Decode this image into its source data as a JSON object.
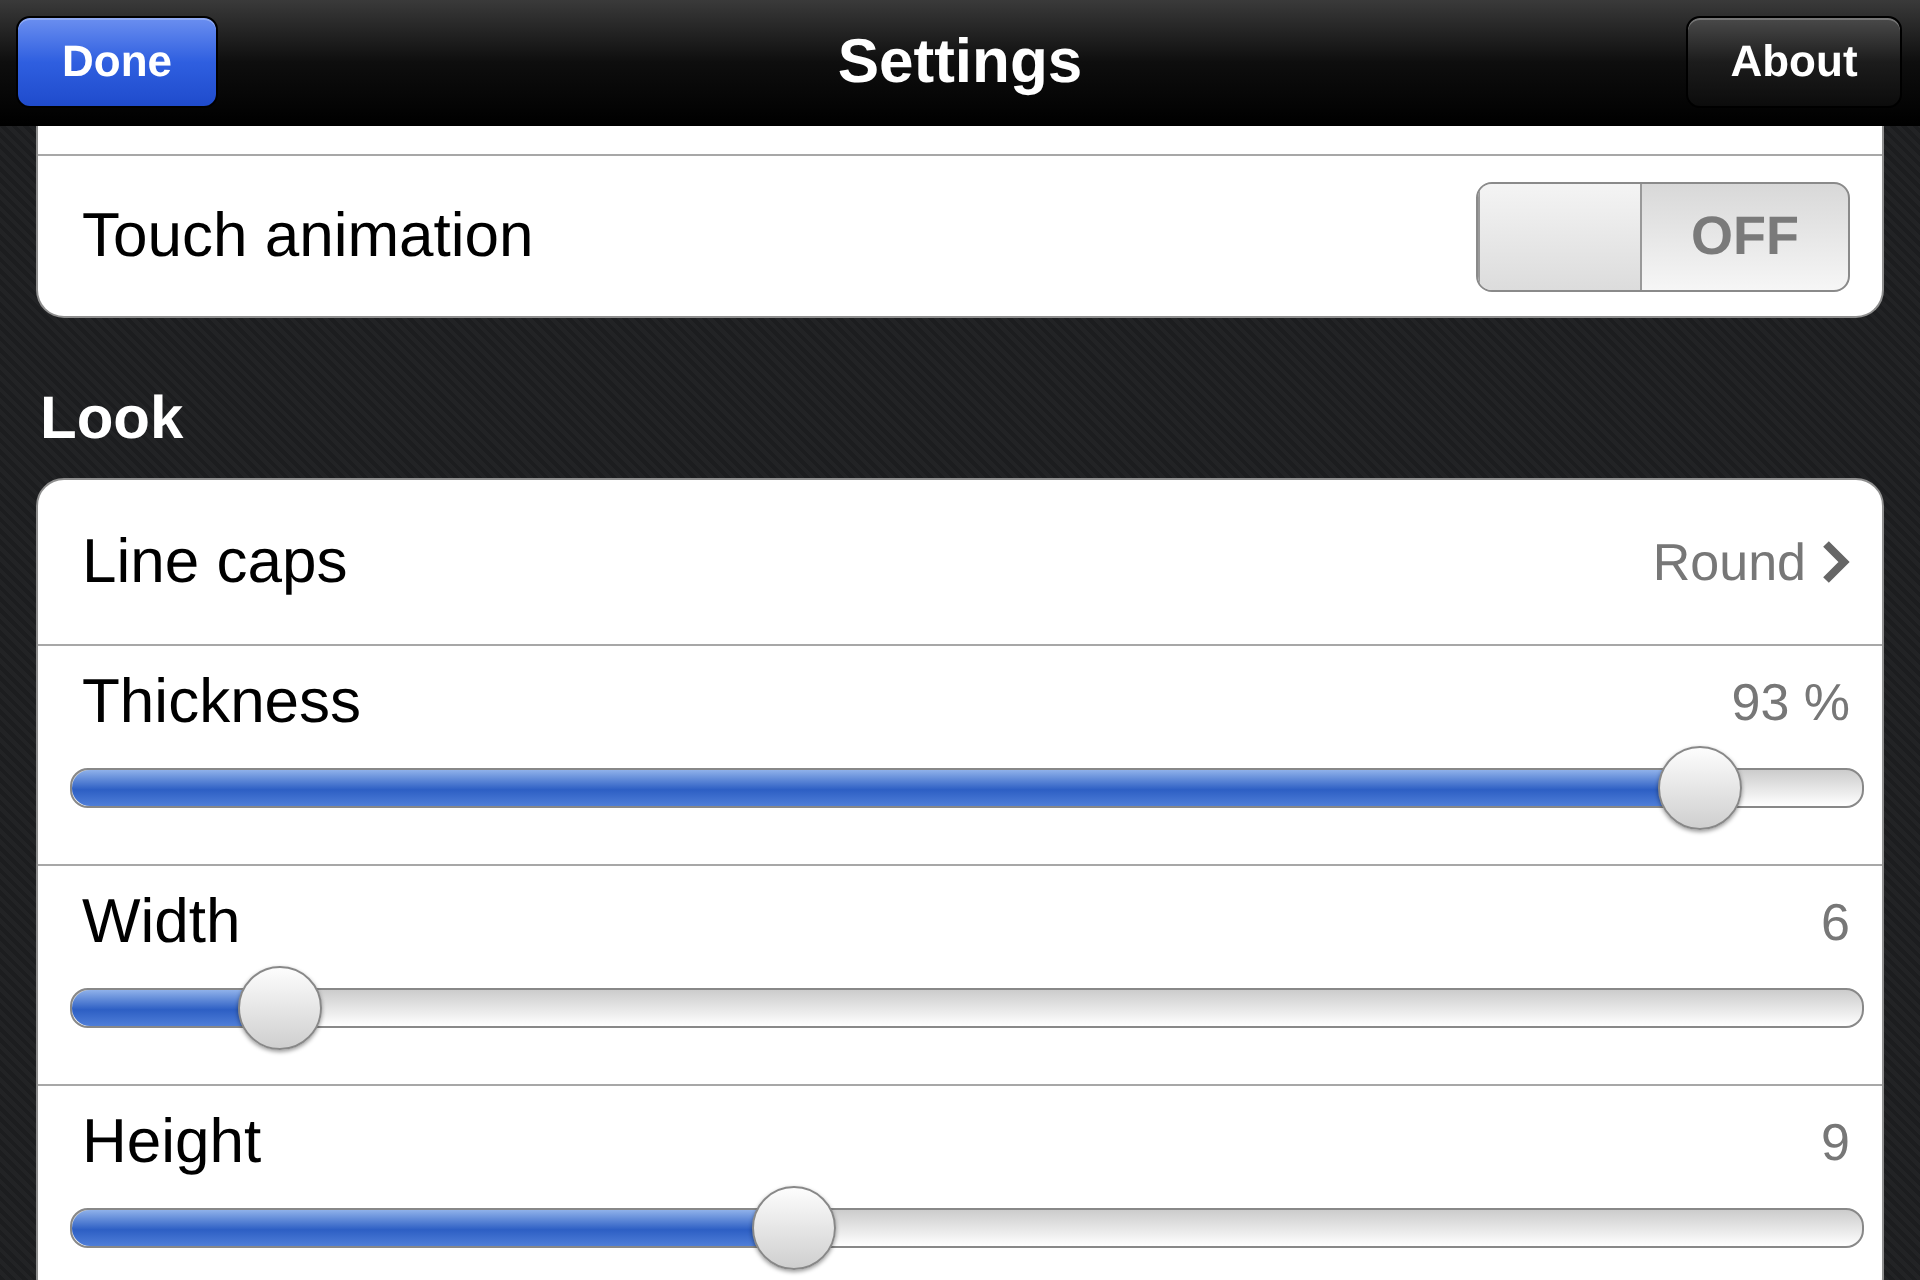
{
  "nav_bar": {
    "title": "Settings",
    "left_button": "Done",
    "right_button": "About"
  },
  "sections": [
    {
      "rows": [
        {
          "kind": "toggle",
          "label": "Touch animation",
          "on": false,
          "switch_text": "OFF"
        }
      ]
    },
    {
      "header": "Look",
      "rows": [
        {
          "kind": "choice",
          "label": "Line caps",
          "value": "Round"
        },
        {
          "kind": "slider",
          "label": "Thickness",
          "value": "93 %",
          "level": 0.91
        },
        {
          "kind": "slider",
          "label": "Width",
          "value": "6",
          "level": 0.116
        },
        {
          "kind": "slider",
          "label": "Height",
          "value": "9",
          "level": 0.403
        }
      ]
    }
  ]
}
